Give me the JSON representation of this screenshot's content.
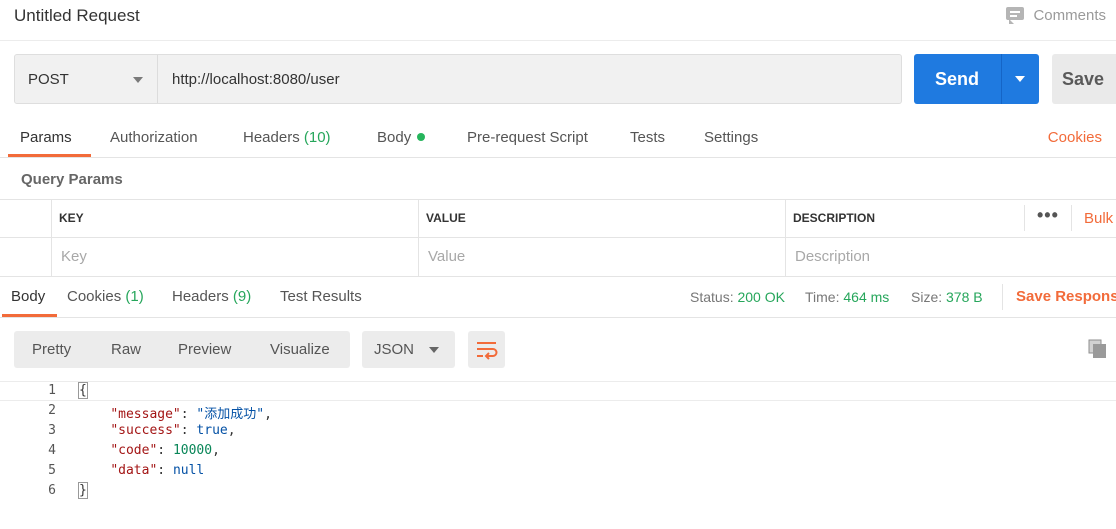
{
  "request": {
    "title": "Untitled Request",
    "comments_label": "Comments",
    "method": "POST",
    "url": "http://localhost:8080/user",
    "send_label": "Send",
    "save_label": "Save"
  },
  "request_tabs": {
    "params": "Params",
    "authorization": "Authorization",
    "headers": "Headers",
    "headers_count": "(10)",
    "body": "Body",
    "pre_request": "Pre-request Script",
    "tests": "Tests",
    "settings": "Settings",
    "cookies": "Cookies"
  },
  "query_params": {
    "heading": "Query Params",
    "columns": [
      "KEY",
      "VALUE",
      "DESCRIPTION"
    ],
    "more": "•••",
    "bulk": "Bulk",
    "placeholders": [
      "Key",
      "Value",
      "Description"
    ]
  },
  "response_tabs": {
    "body": "Body",
    "cookies": "Cookies",
    "cookies_count": "(1)",
    "headers": "Headers",
    "headers_count": "(9)",
    "test_results": "Test Results"
  },
  "response_meta": {
    "status_label": "Status:",
    "status_value": "200 OK",
    "time_label": "Time:",
    "time_value": "464 ms",
    "size_label": "Size:",
    "size_value": "378 B",
    "save_response": "Save Response"
  },
  "view": {
    "modes": [
      "Pretty",
      "Raw",
      "Preview",
      "Visualize"
    ],
    "format": "JSON"
  },
  "response_body": {
    "line_numbers": [
      "1",
      "2",
      "3",
      "4",
      "5",
      "6"
    ],
    "open": "{",
    "close": "}",
    "message_key": "\"message\"",
    "message_value": "\"添加成功\"",
    "success_key": "\"success\"",
    "success_value": "true",
    "code_key": "\"code\"",
    "code_value": "10000",
    "data_key": "\"data\"",
    "data_value": "null"
  },
  "colors": {
    "accent": "#f26b3a",
    "send_button": "#1f7ae0",
    "status_ok": "#26a65b"
  }
}
